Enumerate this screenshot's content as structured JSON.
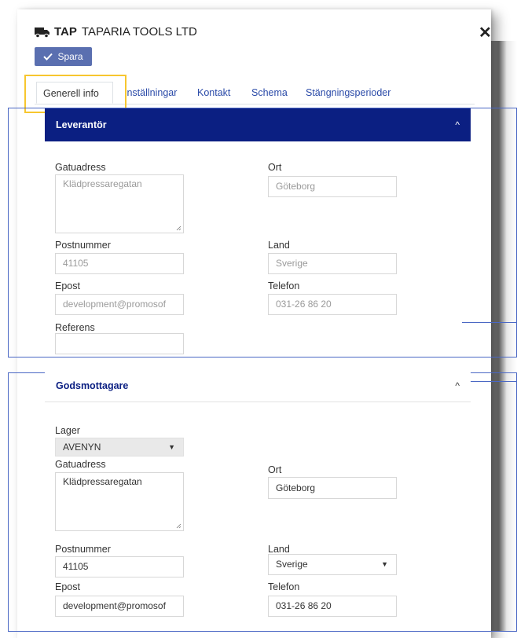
{
  "header": {
    "code": "TAP",
    "company": "TAPARIA TOOLS LTD",
    "save_label": "Spara"
  },
  "tabs": [
    {
      "label": "Generell info"
    },
    {
      "label": "Inställningar"
    },
    {
      "label": "Kontakt"
    },
    {
      "label": "Schema"
    },
    {
      "label": "Stängningsperioder"
    }
  ],
  "supplier": {
    "title": "Leverantör",
    "street_label": "Gatuadress",
    "street_value": "Klädpressaregatan",
    "city_label": "Ort",
    "city_value": "Göteborg",
    "postal_label": "Postnummer",
    "postal_value": "41105",
    "country_label": "Land",
    "country_value": "Sverige",
    "email_label": "Epost",
    "email_value": "development@promosof",
    "phone_label": "Telefon",
    "phone_value": "031-26 86 20",
    "reference_label": "Referens",
    "reference_value": ""
  },
  "consignee": {
    "title": "Godsmottagare",
    "warehouse_label": "Lager",
    "warehouse_value": "AVENYN",
    "street_label": "Gatuadress",
    "street_value": "Klädpressaregatan",
    "city_label": "Ort",
    "city_value": "Göteborg",
    "postal_label": "Postnummer",
    "postal_value": "41105",
    "country_label": "Land",
    "country_value": "Sverige",
    "email_label": "Epost",
    "email_value": "development@promosof",
    "phone_label": "Telefon",
    "phone_value": "031-26 86 20"
  },
  "icons": {
    "truck": "truck-icon",
    "check": "check-icon",
    "close": "close-icon",
    "chevron": "chevron-up-icon",
    "caret": "caret-down-icon"
  },
  "colors": {
    "primary": "#0b1f82",
    "button": "#5a6fb0",
    "link": "#2a4aa8",
    "highlight": "#f7c62f",
    "annotation": "#4a67c4"
  }
}
